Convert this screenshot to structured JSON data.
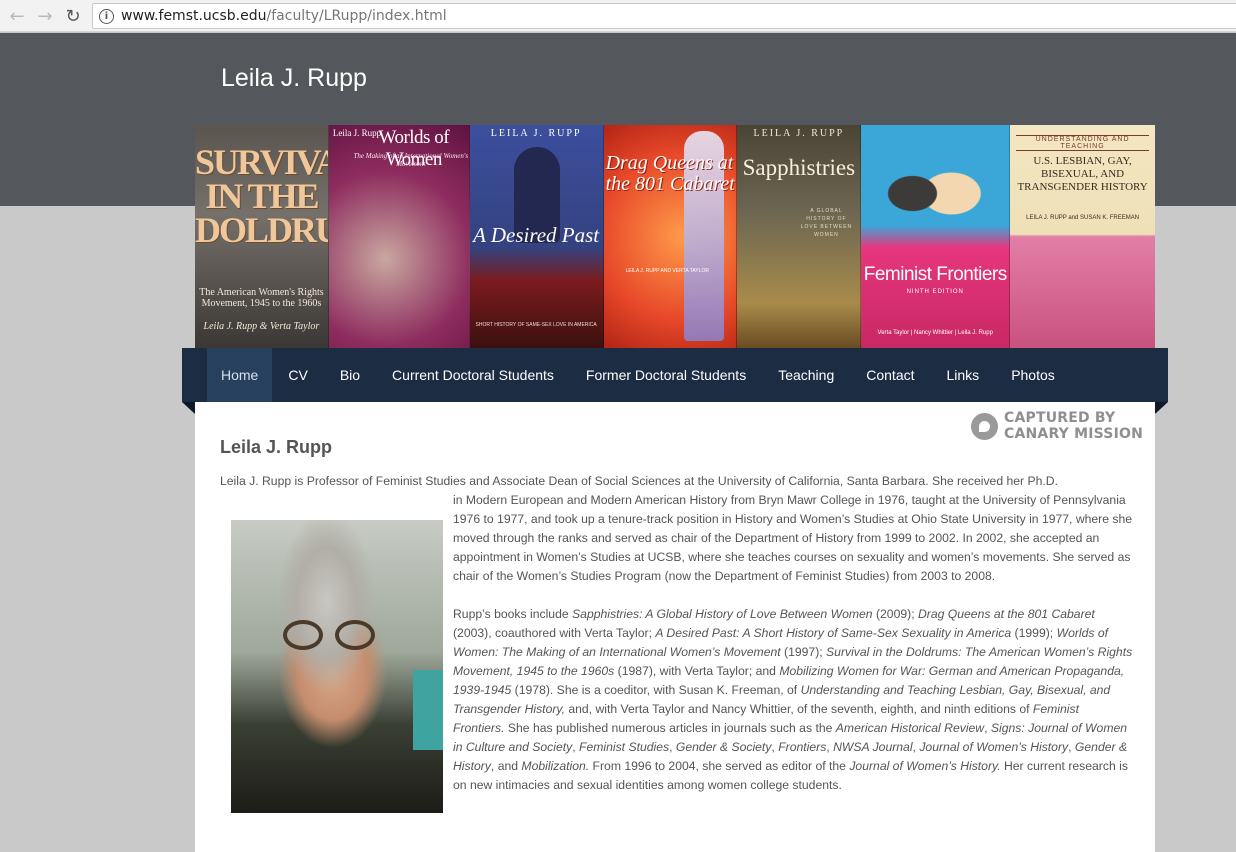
{
  "browser": {
    "back_glyph": "←",
    "forward_glyph": "→",
    "reload_glyph": "↻",
    "info_glyph": "i",
    "url_host": "www.femst.ucsb.edu",
    "url_path": "/faculty/LRupp/index.html"
  },
  "site": {
    "title": "Leila J. Rupp",
    "header_color": "#54585c",
    "nav_color": "#1c2c43"
  },
  "banner": {
    "book1": {
      "title": "SURVIVAL IN THE DOLDRUMS",
      "subtitle": "The American Women's Rights Movement, 1945 to the 1960s",
      "authors": "Leila J. Rupp & Verta Taylor"
    },
    "book2": {
      "author": "Leila J. Rupp",
      "title": "Worlds of Women",
      "subtitle": "The Making of an International Women's Movement"
    },
    "book3": {
      "author": "LEILA J. RUPP",
      "title": "A Desired Past",
      "subtitle": "SHORT HISTORY OF SAME-SEX LOVE IN AMERICA"
    },
    "book4": {
      "title": "Drag Queens at the 801 Cabaret",
      "authors": "LEILA J. RUPP AND VERTA TAYLOR"
    },
    "book5": {
      "author": "LEILA J. RUPP",
      "title": "Sapphistries",
      "subtitle": "A GLOBAL HISTORY OF LOVE BETWEEN WOMEN"
    },
    "book6": {
      "title": "Feminist Frontiers",
      "edition": "NINTH EDITION",
      "authors": "Verta Taylor | Nancy Whittier | Leila J. Rupp"
    },
    "book7": {
      "band": "UNDERSTANDING AND TEACHING",
      "title": "U.S. LESBIAN, GAY, BISEXUAL, AND TRANSGENDER HISTORY",
      "editors": "LEILA J. RUPP and SUSAN K. FREEMAN"
    }
  },
  "nav": {
    "items": [
      {
        "label": "Home",
        "current": true
      },
      {
        "label": "CV"
      },
      {
        "label": "Bio"
      },
      {
        "label": "Current Doctoral Students"
      },
      {
        "label": "Former Doctoral Students"
      },
      {
        "label": "Teaching"
      },
      {
        "label": "Contact"
      },
      {
        "label": "Links"
      },
      {
        "label": "Photos"
      }
    ]
  },
  "watermark": {
    "line1": "CAPTURED BY",
    "line2": "CANARY MISSION"
  },
  "main": {
    "heading": "Leila J. Rupp",
    "intro": "Leila J. Rupp is Professor of Feminist Studies and Associate Dean of Social Sciences at the University of California, Santa Barbara.  She received her Ph.D.",
    "p1": "in Modern European and Modern American History from Bryn Mawr College in 1976, taught at the University of Pennsylvania 1976 to 1977, and took up a tenure-track position in History and Women’s Studies at Ohio State University in 1977, where she moved through the ranks and served as chair of the Department of History from 1999 to 2002.  In 2002, she accepted an appointment in Women’s Studies at UCSB, where she teaches courses on sexuality and women’s movements.  She served as chair of the Women’s Studies Program (now the Department of Feminist Studies) from 2003 to 2008.",
    "p2": [
      {
        "t": "Rupp’s books include "
      },
      {
        "i": "Sapphistries: A Global History of Love Between Women"
      },
      {
        "t": " (2009); "
      },
      {
        "i": "Drag Queens at the 801 Cabaret"
      },
      {
        "t": " (2003), coauthored with Verta Taylor; "
      },
      {
        "i": "A Desired Past: A Short History of Same-Sex Sexuality in America"
      },
      {
        "t": " (1999); "
      },
      {
        "i": "Worlds of Women: The Making of an International Women’s Movement"
      },
      {
        "t": " (1997); "
      },
      {
        "i": "Survival in the Doldrums: The American Women’s Rights Movement, 1945 to the 1960s"
      },
      {
        "t": " (1987), with Verta Taylor; and "
      },
      {
        "i": "Mobilizing Women for War: German and American Propaganda, 1939-1945"
      },
      {
        "t": " (1978).  She is a coeditor, with Susan K. Freeman, of "
      },
      {
        "i": "Understanding and Teaching Lesbian, Gay, Bisexual, and Transgender History,"
      },
      {
        "t": " and, with Verta Taylor and Nancy Whittier, of the seventh, eighth, and ninth editions of "
      },
      {
        "i": "Feminist Frontiers."
      },
      {
        "t": "  She has published numerous articles in journals such as the "
      },
      {
        "i": "American Historical Review"
      },
      {
        "t": ", "
      },
      {
        "i": "Signs: Journal of Women in Culture and Society"
      },
      {
        "t": ", "
      },
      {
        "i": "Feminist Studies"
      },
      {
        "t": ", "
      },
      {
        "i": "Gender & Society"
      },
      {
        "t": ", "
      },
      {
        "i": "Frontiers"
      },
      {
        "t": ", "
      },
      {
        "i": "NWSA Journal"
      },
      {
        "t": ", "
      },
      {
        "i": "Journal of Women’s History"
      },
      {
        "t": ", "
      },
      {
        "i": "Gender & History"
      },
      {
        "t": ", and "
      },
      {
        "i": "Mobilization."
      },
      {
        "t": "  From 1996 to 2004, she served as editor of the "
      },
      {
        "i": "Journal of Women’s History."
      },
      {
        "t": "  Her current research is on new intimacies and sexual identities among women college students."
      }
    ]
  }
}
